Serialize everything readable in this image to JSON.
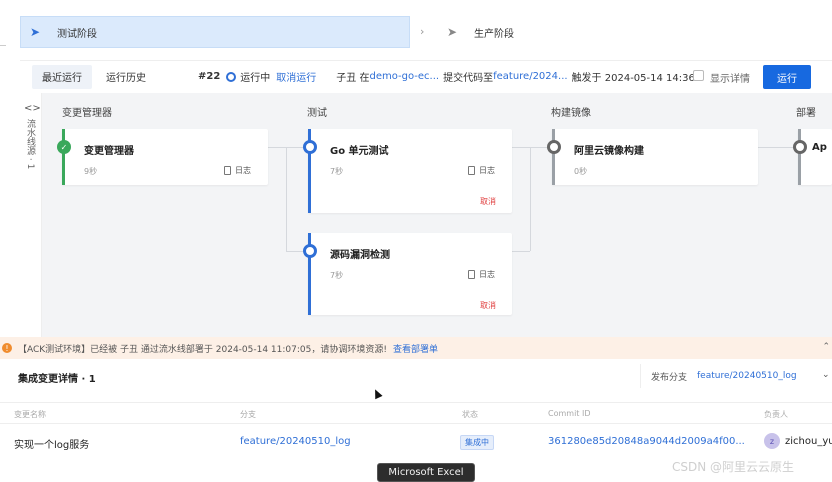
{
  "stages": {
    "active": {
      "label": "测试阶段"
    },
    "next": {
      "label": "生产阶段"
    }
  },
  "runbar": {
    "tabs": [
      "最近运行",
      "运行历史"
    ],
    "run_number": "#22",
    "status": "运行中",
    "cancel": "取消运行",
    "author_prefix": "子丑 在",
    "repo": "demo-go-ec...",
    "commit_text": "提交代码至",
    "branch": "feature/2024...",
    "trigger": "触发于 2024-05-14 14:36",
    "show_details": "显示详情",
    "run_button": "运行"
  },
  "pipeline": {
    "side_label": "流水线源 · 1",
    "columns": [
      "变更管理器",
      "测试",
      "构建镜像",
      "部署"
    ],
    "cards": [
      {
        "title": "变更管理器",
        "duration": "9秒",
        "log": "日志"
      },
      {
        "title": "Go 单元测试",
        "duration": "7秒",
        "log": "日志",
        "cancel": "取消"
      },
      {
        "title": "源码漏洞检测",
        "duration": "7秒",
        "log": "日志",
        "cancel": "取消"
      },
      {
        "title": "阿里云镜像构建",
        "duration": "0秒"
      },
      {
        "title": "Ap"
      }
    ]
  },
  "notice": {
    "text": "【ACK测试环境】已经被 子丑 通过流水线部署于 2024-05-14 11:07:05，请协调环境资源!",
    "link": "查看部署单"
  },
  "changes": {
    "title": "集成变更详情 · 1",
    "branch_label": "发布分支",
    "branch_value": "feature/20240510_log",
    "headers": [
      "变更名称",
      "分支",
      "状态",
      "Commit ID",
      "负责人"
    ],
    "rows": [
      {
        "name": "实现一个log服务",
        "branch": "feature/20240510_log",
        "status": "集成中",
        "commit": "361280e85d20848a9044d2009a4f00...",
        "owner_initial": "z",
        "owner": "zichou_yu"
      }
    ]
  },
  "taskbar": {
    "tooltip": "Microsoft Excel"
  },
  "watermark": "CSDN @阿里云云原生",
  "colors": {
    "primary": "#1769e0",
    "success": "#3aa85b",
    "danger": "#e03e3e",
    "warning": "#f08c2e"
  }
}
